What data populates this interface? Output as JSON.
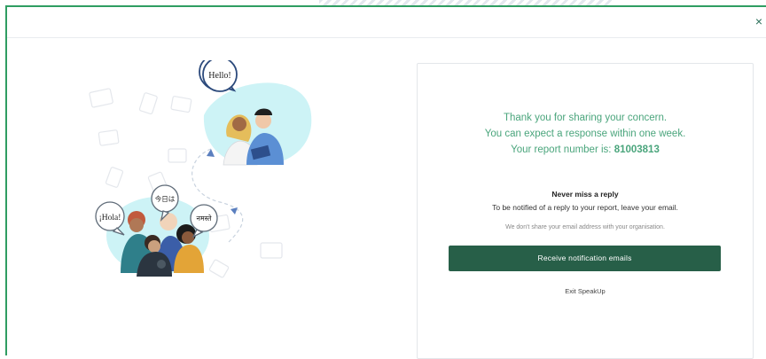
{
  "top_bar": {
    "partial_label": "speakup"
  },
  "modal": {
    "close_symbol": "×",
    "close_icon": "close-icon"
  },
  "illustration": {
    "bubble_hello": "Hello!",
    "bubble_hola": "¡Hola!",
    "bubble_konnichiwa": "今日は",
    "bubble_namaste": "नमस्ते"
  },
  "card": {
    "thanks_line1": "Thank you for sharing your concern.",
    "thanks_line2": "You can expect a response within one week.",
    "report_prefix": "Your report number is:",
    "report_number": "81003813",
    "never_miss": "Never miss a reply",
    "notified_text": "To be notified of a reply to your report, leave your email.",
    "privacy_note": "We don't share your email address with your organisation.",
    "notify_button": "Receive notification emails",
    "exit_link": "Exit SpeakUp"
  },
  "colors": {
    "accent_green": "#4aa57c",
    "button_green": "#275f48",
    "modal_border": "#2f9d62"
  }
}
